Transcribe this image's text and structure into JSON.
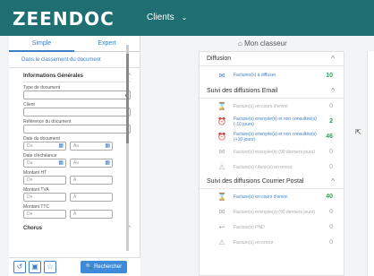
{
  "header": {
    "logo": "ZEENDOC",
    "nav_label": "Clients",
    "nav_icon": "chevron-down-icon"
  },
  "sidebar": {
    "tabs": [
      "Simple",
      "Expert"
    ],
    "section_title": "Dans le classement du document",
    "subsection_title": "Informations Générales",
    "fields": {
      "type_document": "Type de document",
      "client": "Client",
      "reference": "Référence du document",
      "date_document": "Date du document",
      "date_echeance": "Date d'échéance",
      "montant_ht": "Montant HT",
      "montant_tva": "Montant TVA",
      "montant_ttc": "Montant TTC"
    },
    "placeholders": {
      "du": "Du",
      "au": "Au",
      "de": "De",
      "a": "À"
    },
    "chorus": "Chorus",
    "search_button": "Rechercher"
  },
  "main": {
    "title": "Mon classeur",
    "groups": [
      {
        "title": "Diffusion",
        "items": [
          {
            "label": "Factures(s) à diffuser",
            "count": "10",
            "muted": false,
            "icon": "send-icon"
          }
        ]
      },
      {
        "title": "Suivi des diffusions Email",
        "items": [
          {
            "label": "Facture(s) en cours d'envoi",
            "count": "0",
            "muted": true,
            "icon": "hourglass-icon"
          },
          {
            "label": "Facture(s) envoyée(s) et non consultée(s) (-10 jours)",
            "count": "2",
            "muted": false,
            "icon": "mail-alarm-icon"
          },
          {
            "label": "Facture(s) envoyée(s) et non consultée(s) (+10 jours)",
            "count": "46",
            "muted": false,
            "icon": "mail-alarm-icon"
          },
          {
            "label": "Facture(s) envoyée(s) (90 derniers jours)",
            "count": "0",
            "muted": true,
            "icon": "mail-icon"
          },
          {
            "label": "Facture(s) / Avoir(s) en erreur",
            "count": "0",
            "muted": true,
            "icon": "warning-icon"
          }
        ]
      },
      {
        "title": "Suivi des diffusions Courrier Postal",
        "items": [
          {
            "label": "Facture(s) en cours d'envoi",
            "count": "40",
            "muted": false,
            "icon": "hourglass-icon"
          },
          {
            "label": "Facture(s) envoyée(s) (90 derniers jours)",
            "count": "0",
            "muted": true,
            "icon": "mail-icon"
          },
          {
            "label": "Facture(s) PND",
            "count": "0",
            "muted": true,
            "icon": "mail-return-icon"
          },
          {
            "label": "Facture(s) en erreur",
            "count": "0",
            "muted": true,
            "icon": "warning-icon"
          }
        ]
      }
    ]
  }
}
